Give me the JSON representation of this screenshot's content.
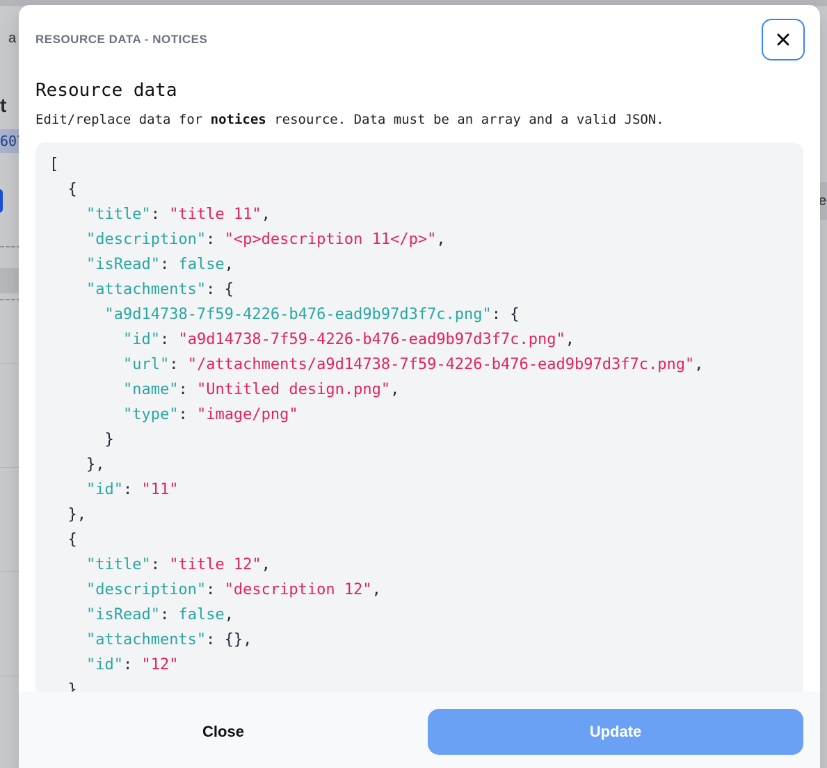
{
  "background": {
    "partial_text_a": "a",
    "partial_text_t": "t",
    "partial_number": "607",
    "partial_right": "e"
  },
  "modal": {
    "header": "RESOURCE DATA - NOTICES",
    "close_icon": "close-x-icon",
    "title": "Resource data",
    "description_prefix": "Edit/replace data for ",
    "resource_name": "notices",
    "description_suffix": " resource. Data must be an array and a valid JSON.",
    "footer": {
      "close_label": "Close",
      "update_label": "Update"
    },
    "colors": {
      "accent": "#3b82f6",
      "update_button": "#6aa1f4",
      "json_key": "#2ba6a0",
      "json_string": "#e0245e"
    }
  },
  "editor": {
    "lines": [
      "[",
      "  {",
      "    \"title\": \"title 11\",",
      "    \"description\": \"<p>description 11</p>\",",
      "    \"isRead\": false,",
      "    \"attachments\": {",
      "      \"a9d14738-7f59-4226-b476-ead9b97d3f7c.png\": {",
      "        \"id\": \"a9d14738-7f59-4226-b476-ead9b97d3f7c.png\",",
      "        \"url\": \"/attachments/a9d14738-7f59-4226-b476-ead9b97d3f7c.png\",",
      "        \"name\": \"Untitled design.png\",",
      "        \"type\": \"image/png\"",
      "      }",
      "    },",
      "    \"id\": \"11\"",
      "  },",
      "  {",
      "    \"title\": \"title 12\",",
      "    \"description\": \"description 12\",",
      "    \"isRead\": false,",
      "    \"attachments\": {},",
      "    \"id\": \"12\"",
      "  }"
    ]
  }
}
